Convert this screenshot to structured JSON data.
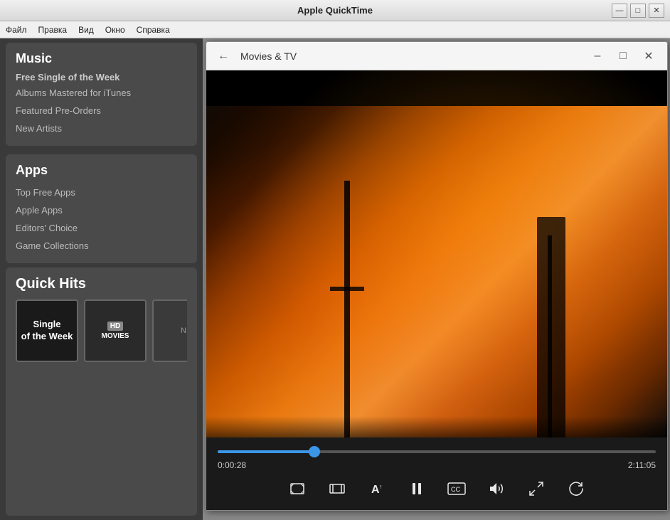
{
  "window": {
    "title": "Apple QuickTime",
    "minimize_label": "—",
    "maximize_label": "□",
    "close_label": "✕"
  },
  "menu": {
    "items": [
      "Файл",
      "Правка",
      "Вид",
      "Окно",
      "Справка"
    ]
  },
  "sidebar": {
    "music_section": {
      "title": "Music",
      "subtitle": "Free Single of the Week",
      "links": [
        "Albums Mastered for iTunes",
        "Featured Pre-Orders",
        "New Artists"
      ]
    },
    "apps_section": {
      "title": "Apps",
      "links": [
        "Top Free Apps",
        "Apple Apps",
        "Editors' Choice",
        "Game Collections"
      ]
    },
    "quick_hits": {
      "title": "Quick Hits",
      "item1_line1": "Single",
      "item1_line2": "of the Week",
      "item2_hd": "HD",
      "item2_label": "MOVIES",
      "item3_label": "N"
    }
  },
  "player": {
    "window_title": "Movies & TV",
    "current_time": "0:00:28",
    "total_time": "2:11:05",
    "progress_percent": 0.22,
    "controls": {
      "aspect_ratio_label": "⬜",
      "trim_label": "⊟",
      "text_label": "A↑",
      "pause_label": "⏸",
      "captions_label": "CC",
      "volume_label": "🔊",
      "fullscreen_label": "⤢",
      "replay_label": "↺"
    }
  }
}
